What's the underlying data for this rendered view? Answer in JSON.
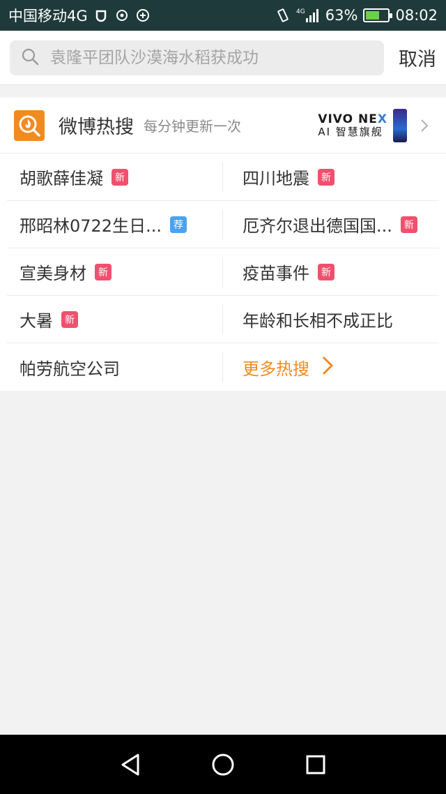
{
  "status_bar": {
    "carrier": "中国移动4G",
    "network": "4G",
    "battery_percent": "63%",
    "battery_level": 0.63,
    "time": "08:02"
  },
  "search": {
    "placeholder": "袁隆平团队沙漠海水稻获成功",
    "cancel_label": "取消"
  },
  "hot_search": {
    "title": "微博热搜",
    "subtitle": "每分钟更新一次",
    "ad": {
      "brand_a": "VIVO NE",
      "brand_b": "X",
      "slogan": "AI 智慧旗舰"
    },
    "items": [
      {
        "text": "胡歌薛佳凝",
        "badge": "新",
        "badge_color": "#f0506e"
      },
      {
        "text": "四川地震",
        "badge": "新",
        "badge_color": "#f0506e"
      },
      {
        "text": "邢昭林0722生日...",
        "badge": "荐",
        "badge_color": "#4aa3f0"
      },
      {
        "text": "厄齐尔退出德国国...",
        "badge": "新",
        "badge_color": "#f0506e"
      },
      {
        "text": "宣美身材",
        "badge": "新",
        "badge_color": "#f0506e"
      },
      {
        "text": "疫苗事件",
        "badge": "新",
        "badge_color": "#f0506e"
      },
      {
        "text": "大暑",
        "badge": "新",
        "badge_color": "#f0506e"
      },
      {
        "text": "年龄和长相不成正比",
        "badge": "",
        "badge_color": ""
      },
      {
        "text": "帕劳航空公司",
        "badge": "",
        "badge_color": ""
      }
    ],
    "more_label": "更多热搜"
  },
  "colors": {
    "accent_orange": "#f28a1e",
    "badge_new": "#f0506e",
    "badge_recommend": "#4aa3f0",
    "status_bar_bg": "#1f3a3a"
  }
}
